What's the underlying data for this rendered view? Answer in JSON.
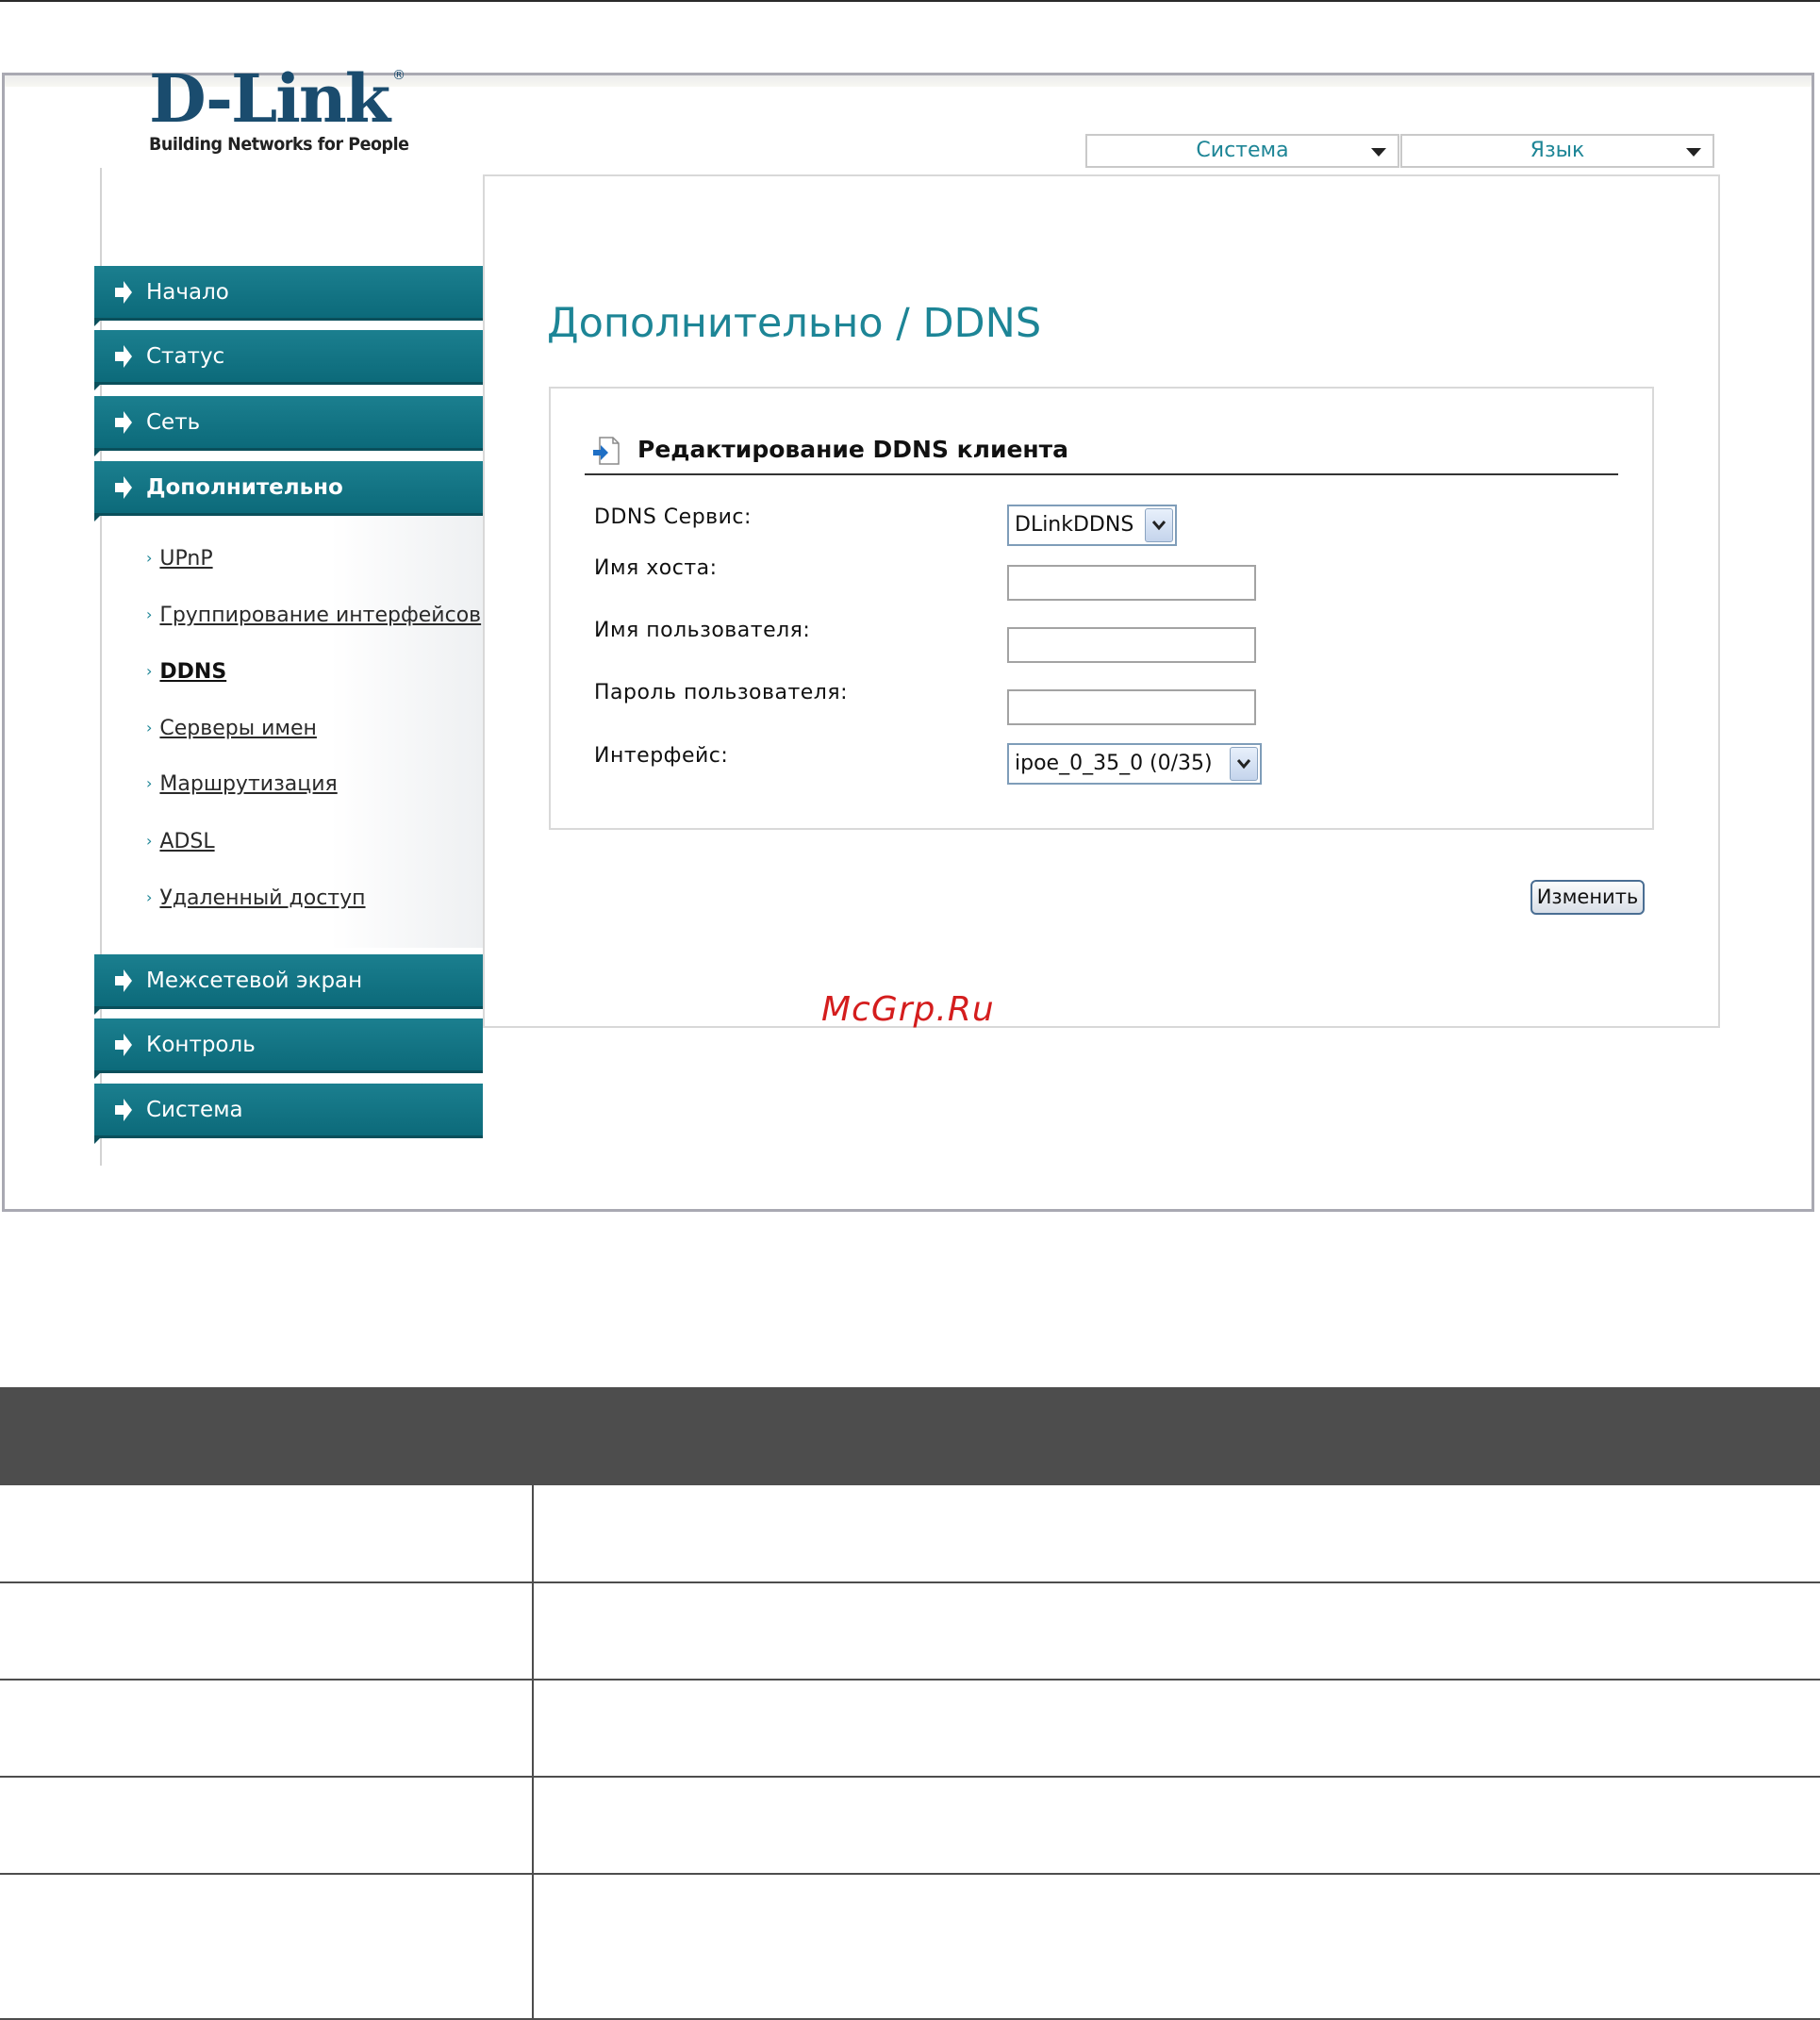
{
  "logo": {
    "brand": "D-Link",
    "registered": "®",
    "tagline": "Building Networks for People"
  },
  "top_menu": {
    "system_label": "Система",
    "language_label": "Язык"
  },
  "sidebar": {
    "items_top": [
      {
        "label": "Начало"
      },
      {
        "label": "Статус"
      },
      {
        "label": "Сеть"
      },
      {
        "label": "Дополнительно"
      }
    ],
    "subitems": [
      {
        "label": "UPnP"
      },
      {
        "label": "Группирование интерфейсов"
      },
      {
        "label": "DDNS"
      },
      {
        "label": "Серверы имен"
      },
      {
        "label": "Маршрутизация"
      },
      {
        "label": "ADSL"
      },
      {
        "label": "Удаленный доступ"
      }
    ],
    "items_bottom": [
      {
        "label": "Межсетевой экран"
      },
      {
        "label": "Контроль"
      },
      {
        "label": "Система"
      }
    ]
  },
  "page": {
    "title": "Дополнительно / DDNS",
    "section_title": "Редактирование DDNS клиента",
    "fields": {
      "service_label": "DDNS Сервис:",
      "service_value": "DLinkDDNS",
      "hostname_label": "Имя хоста:",
      "hostname_value": "",
      "username_label": "Имя пользователя:",
      "username_value": "",
      "password_label": "Пароль пользователя:",
      "password_value": "",
      "interface_label": "Интерфейс:",
      "interface_value": "ipoe_0_35_0 (0/35)"
    },
    "apply_label": "Изменить"
  },
  "watermark": "McGrp.Ru",
  "colors": {
    "accent": "#1d8596",
    "nav_bg": "#0c6a7a",
    "table_header": "#4d4d4d",
    "watermark": "#d41d1d"
  }
}
